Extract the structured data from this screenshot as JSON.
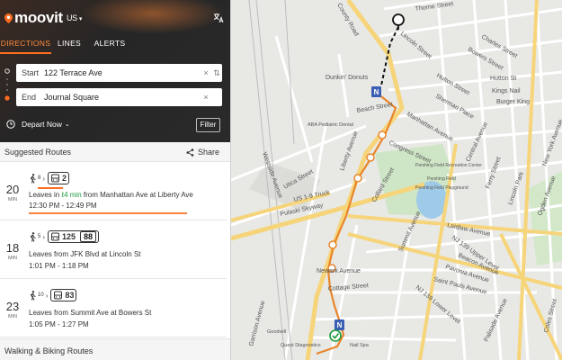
{
  "app": {
    "brand": "moovit",
    "region": "US"
  },
  "tabs": [
    {
      "label": "DIRECTIONS",
      "active": true
    },
    {
      "label": "LINES",
      "active": false
    },
    {
      "label": "ALERTS",
      "active": false
    }
  ],
  "search": {
    "start_label": "Start",
    "start_value": "122 Terrace Ave",
    "end_label": "End",
    "end_value": "Journal Square"
  },
  "depart": {
    "label": "Depart Now",
    "filter_label": "Filter"
  },
  "routes_header": {
    "title": "Suggested Routes",
    "share_label": "Share"
  },
  "routes": [
    {
      "duration": "20",
      "unit": "MIN",
      "walk_minutes": "8",
      "lines": [
        "2"
      ],
      "leaves_prefix": "Leaves in",
      "live_wait": "4 min",
      "leaves_suffix": "from Manhattan Ave at Liberty Ave",
      "times": "12:30 PM - 12:49 PM"
    },
    {
      "duration": "18",
      "unit": "MIN",
      "walk_minutes": "5",
      "lines": [
        "125",
        "88"
      ],
      "leaves": "Leaves from JFK Blvd at Lincoln St",
      "times": "1:01 PM - 1:18 PM"
    },
    {
      "duration": "23",
      "unit": "MIN",
      "walk_minutes": "10",
      "lines": [
        "83"
      ],
      "leaves": "Leaves from Summit Ave at Bowers St",
      "times": "1:05 PM - 1:27 PM"
    }
  ],
  "walking_biking": {
    "label": "Walking & Biking Routes"
  },
  "map": {
    "streets": [
      "County Road",
      "Thorne Street",
      "Lincoln Street",
      "Charles Street",
      "Bowers Street",
      "Hutton Street",
      "Sherman Place",
      "Hutton St",
      "Kings Nail",
      "Burger King",
      "Dunkin' Donuts",
      "Beach Street",
      "Manhattan Avenue",
      "Central Avenue",
      "Congress Street",
      "Liberty Avenue",
      "Ferry Street",
      "Pershing Field",
      "Pershing Field Recreation Center",
      "Pershing Field Playground",
      "Westside Avenue",
      "ABA Pediatric Dental",
      "Utica Street",
      "Collard Street",
      "US 1-9 Truck",
      "Pulaski Skyway",
      "Summit Avenue",
      "Laidlaw Avenue",
      "Lincoln Park",
      "New York Avenue",
      "Ogden Avenue",
      "NJ 139 Upper Level",
      "Beacon Avenue",
      "Pavonia Avenue",
      "Saint Pauls Avenue",
      "Newark Avenue",
      "Cottage Street",
      "Palisade Avenue",
      "Garrison Avenue",
      "NJ 139 Lower Level",
      "Goodwill",
      "Quest Diagnostics",
      "Nail Spa",
      "Coles Street"
    ]
  },
  "colors": {
    "accent": "#ff6d1f",
    "route_line": "#e8862c",
    "topbar": "#2a2a2a",
    "live": "#1a9b3a"
  }
}
